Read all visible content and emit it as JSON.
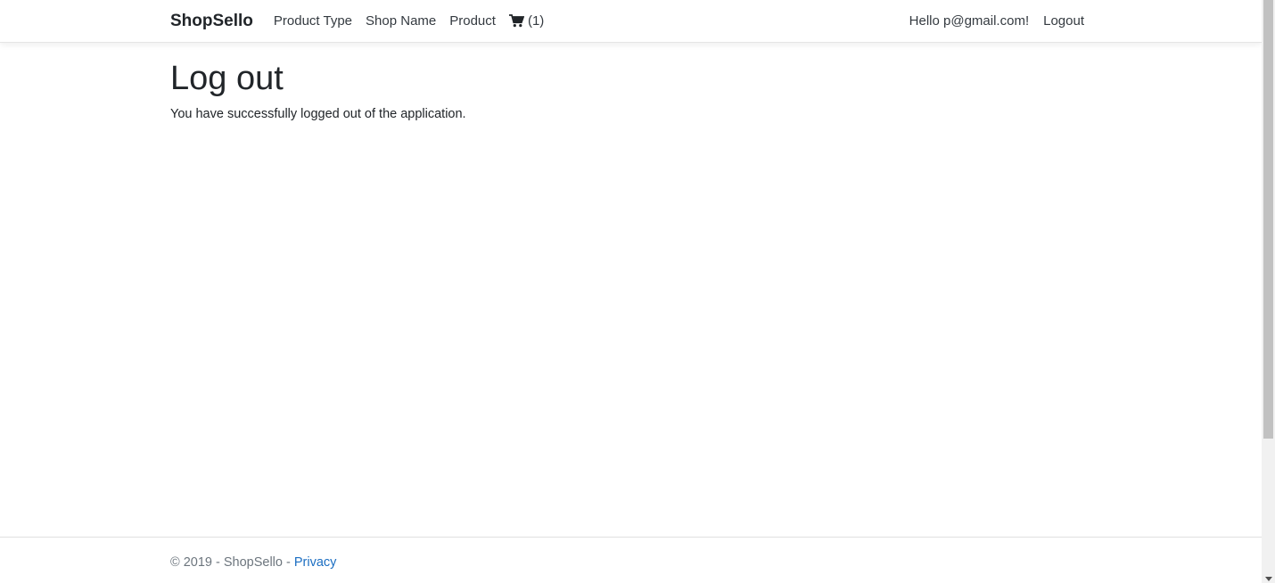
{
  "navbar": {
    "brand": "ShopSello",
    "links": [
      "Product Type",
      "Shop Name",
      "Product"
    ],
    "cart_icon": "cart-icon",
    "cart_count": "(1)",
    "greeting": "Hello p@gmail.com!",
    "logout_label": "Logout"
  },
  "main": {
    "title": "Log out",
    "message": "You have successfully logged out of the application."
  },
  "footer": {
    "copyright": "© 2019 - ShopSello - ",
    "privacy_label": "Privacy"
  },
  "colors": {
    "link": "#1b6ec2",
    "text": "#212529"
  }
}
